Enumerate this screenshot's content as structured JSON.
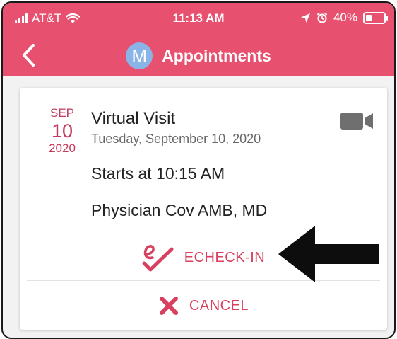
{
  "status_bar": {
    "carrier": "AT&T",
    "time": "11:13 AM",
    "battery": "40%",
    "battery_level": 0.4
  },
  "nav": {
    "avatar_initial": "M",
    "title": "Appointments"
  },
  "appointment": {
    "month": "SEP",
    "day": "10",
    "year": "2020",
    "title": "Virtual Visit",
    "date_full": "Tuesday, September 10, 2020",
    "start_time": "Starts at 10:15 AM",
    "physician": "Physician Cov AMB, MD",
    "type_icon": "video-camera-icon"
  },
  "actions": {
    "echeckin_label": "ECHECK-IN",
    "cancel_label": "CANCEL"
  },
  "colors": {
    "brand": "#e8506f",
    "accent_text": "#d8405f",
    "date_text": "#c23a5c",
    "avatar": "#8ab4e6"
  }
}
